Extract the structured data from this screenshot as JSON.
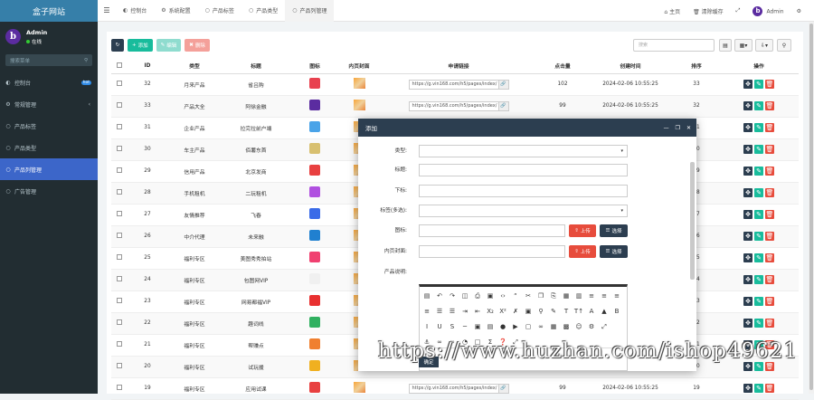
{
  "app": {
    "title": "盒子网站"
  },
  "user": {
    "name": "Admin",
    "status": "在线",
    "initial": "b"
  },
  "sidebar": {
    "search_placeholder": "搜索菜单",
    "items": [
      {
        "label": "控制台",
        "badge": "hot"
      },
      {
        "label": "常规管理"
      },
      {
        "label": "产品标签"
      },
      {
        "label": "产品类型"
      },
      {
        "label": "产品列管理"
      },
      {
        "label": "广告管理"
      }
    ]
  },
  "topbar": {
    "tabs": [
      "控制台",
      "系统配置",
      "产品标签",
      "产品类型",
      "产品列管理"
    ],
    "home": "主页",
    "clear_cache": "清除缓存",
    "user": "Admin"
  },
  "toolbar": {
    "add": "添加",
    "edit": "编辑",
    "delete": "删除",
    "search_placeholder": "搜索"
  },
  "table": {
    "headers": [
      "ID",
      "类型",
      "标题",
      "图标",
      "内页封面",
      "申请链接",
      "点击量",
      "创建时间",
      "排序",
      "操作"
    ],
    "rows": [
      {
        "id": "32",
        "type": "月来产品",
        "title": "省吕购",
        "link": "https://g.vin168.com/h5/pages/index/",
        "clicks": "102",
        "time": "2024-02-06 10:55:25",
        "sort": "33",
        "icon_color": "#e8414f"
      },
      {
        "id": "33",
        "type": "产品大全",
        "title": "阿徐金融",
        "link": "https://g.vin168.com/h5/pages/index/",
        "clicks": "99",
        "time": "2024-02-06 10:55:25",
        "sort": "32",
        "icon_color": "#5b2ca0"
      },
      {
        "id": "31",
        "type": "企业产品",
        "title": "拉完拉前户端",
        "link": "",
        "clicks": "",
        "time": "",
        "sort": "31",
        "icon_color": "#4aa3e8"
      },
      {
        "id": "30",
        "type": "车主产品",
        "title": "佰薯东首",
        "link": "",
        "clicks": "",
        "time": "",
        "sort": "30",
        "icon_color": "#d8c070"
      },
      {
        "id": "29",
        "type": "信用产品",
        "title": "北京发商",
        "link": "",
        "clicks": "",
        "time": "",
        "sort": "29",
        "icon_color": "#e84040"
      },
      {
        "id": "28",
        "type": "手机租机",
        "title": "二玩租机",
        "link": "",
        "clicks": "",
        "time": "",
        "sort": "28",
        "icon_color": "#b050e0"
      },
      {
        "id": "27",
        "type": "友情推荐",
        "title": "飞春",
        "link": "",
        "clicks": "",
        "time": "",
        "sort": "27",
        "icon_color": "#3a6be8"
      },
      {
        "id": "26",
        "type": "中介代理",
        "title": "未来融",
        "link": "",
        "clicks": "",
        "time": "",
        "sort": "26",
        "icon_color": "#2080d0"
      },
      {
        "id": "25",
        "type": "福利专区",
        "title": "美图秀秀拍站",
        "link": "",
        "clicks": "",
        "time": "",
        "sort": "25",
        "icon_color": "#f04070"
      },
      {
        "id": "24",
        "type": "福利专区",
        "title": "包图网VIP",
        "link": "",
        "clicks": "",
        "time": "",
        "sort": "24",
        "icon_color": "#f0f0f0"
      },
      {
        "id": "23",
        "type": "福利专区",
        "title": "网易都福VIP",
        "link": "",
        "clicks": "",
        "time": "",
        "sort": "23",
        "icon_color": "#e83030"
      },
      {
        "id": "22",
        "type": "福利专区",
        "title": "趣词线",
        "link": "",
        "clicks": "",
        "time": "",
        "sort": "22",
        "icon_color": "#30b060"
      },
      {
        "id": "21",
        "type": "福利专区",
        "title": "帮赚点",
        "link": "",
        "clicks": "",
        "time": "",
        "sort": "21",
        "icon_color": "#f08030"
      },
      {
        "id": "20",
        "type": "福利专区",
        "title": "试玩援",
        "link": "",
        "clicks": "",
        "time": "",
        "sort": "20",
        "icon_color": "#f0b020"
      },
      {
        "id": "19",
        "type": "福利专区",
        "title": "应用试课",
        "link": "https://g.vin168.com/h5/pages/index/",
        "clicks": "99",
        "time": "2024-02-06 10:55:25",
        "sort": "19",
        "icon_color": "#e84040"
      }
    ]
  },
  "modal": {
    "title": "添加",
    "labels": {
      "type": "类型:",
      "title": "标题:",
      "subtitle": "下标:",
      "tags": "标签(多选):",
      "icon": "图标:",
      "cover": "内页封面:",
      "desc": "产品说明:"
    },
    "upload": "上传",
    "select": "选择",
    "confirm": "确定"
  },
  "watermark": "https://www.huzhan.com/ishop49621"
}
